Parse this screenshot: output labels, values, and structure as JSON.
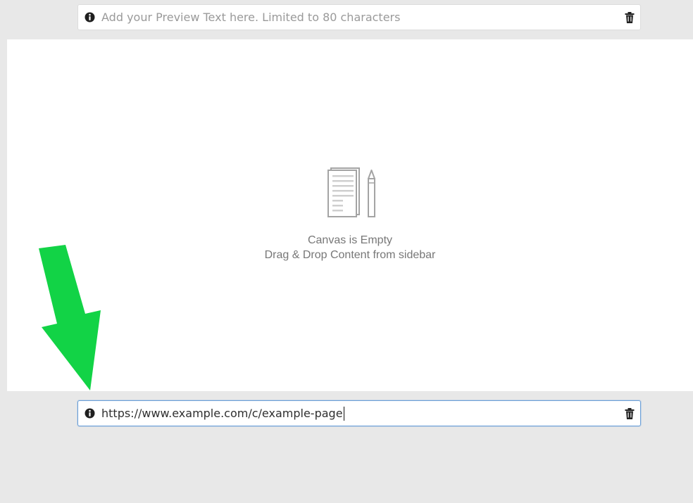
{
  "preview_text_field": {
    "placeholder": "Add your Preview Text here. Limited to 80 characters",
    "info_icon": "info-circle-icon",
    "delete_icon": "trash-icon"
  },
  "canvas": {
    "empty_title": "Canvas is Empty",
    "empty_subtitle": "Drag & Drop Content from sidebar",
    "illustration_icon": "document-pencil-icon"
  },
  "url_field": {
    "value": "https://www.example.com/c/example-page",
    "focused": true,
    "info_icon": "info-circle-icon",
    "delete_icon": "trash-icon"
  },
  "annotation": {
    "arrow_icon": "green-down-arrow",
    "arrow_color": "#12d346"
  },
  "colors": {
    "background": "#e8e8e8",
    "canvas": "#ffffff",
    "focus_border": "#6a9fd8",
    "placeholder_text": "#9a9a9a",
    "empty_text": "#777777"
  }
}
